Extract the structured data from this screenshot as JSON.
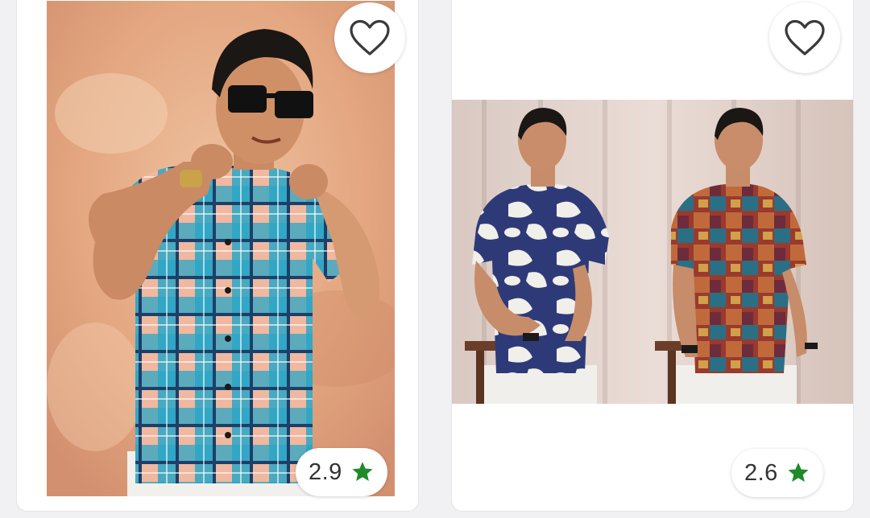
{
  "colors": {
    "page_background": "#f1f1f3",
    "card_background": "#ffffff",
    "rating_star": "#1e8a2a",
    "rating_text": "#333333",
    "heart_outline": "#3a3a3a"
  },
  "products": [
    {
      "wishlist_icon": "heart-outline-icon",
      "rating": "2.9",
      "rating_icon": "star-icon"
    },
    {
      "wishlist_icon": "heart-outline-icon",
      "rating": "2.6",
      "rating_icon": "star-icon"
    }
  ]
}
